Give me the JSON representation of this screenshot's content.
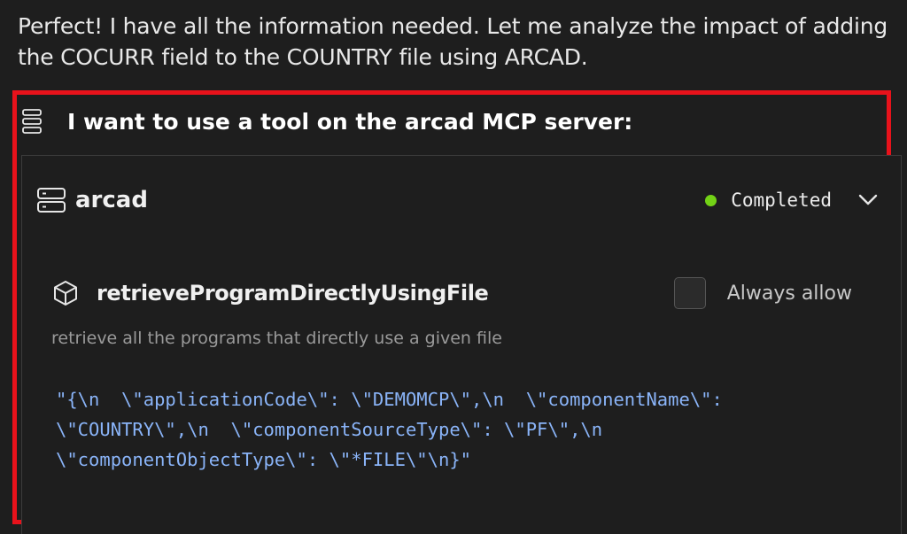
{
  "message": {
    "intro": "Perfect! I have all the information needed. Let me analyze the impact of adding the COCURR field to the COUNTRY file using ARCAD."
  },
  "tool_request": {
    "title": "I want to use a tool on the arcad MCP server:",
    "server": {
      "name": "arcad",
      "status": "Completed",
      "status_color": "#73d216"
    },
    "tool": {
      "name": "retrieveProgramDirectlyUsingFile",
      "description": "retrieve all the programs that directly use a given file",
      "always_allow_label": "Always allow",
      "always_allow_checked": false,
      "arguments": "\"{\\n  \\\"applicationCode\\\": \\\"DEMOMCP\\\",\\n  \\\"componentName\\\":\n\\\"COUNTRY\\\",\\n  \\\"componentSourceType\\\": \\\"PF\\\",\\n\n\\\"componentObjectType\\\": \\\"*FILE\\\"\\n}\""
    }
  },
  "icons": {
    "header": "server-stack-icon",
    "server": "server-icon",
    "tool": "cube-icon",
    "expand": "chevron-down-icon"
  },
  "colors": {
    "highlight_border": "#e8121b",
    "code_text": "#8ab4f8",
    "background": "#1e1e1e"
  }
}
